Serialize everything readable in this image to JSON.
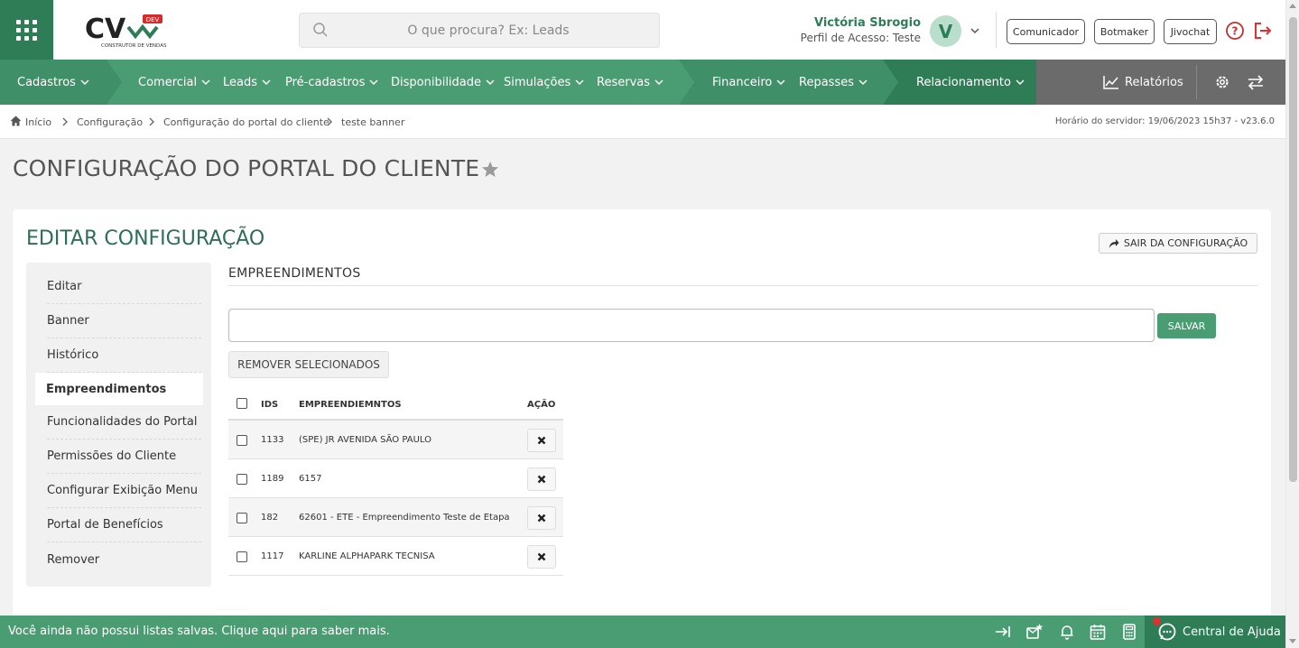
{
  "header": {
    "search_placeholder": "O que procura? Ex: Leads",
    "user_name": "Victória Sbrogio",
    "user_profile": "Perfil de Acesso: Teste",
    "avatar_letter": "V",
    "buttons": [
      "Comunicador",
      "Botmaker",
      "Jivochat"
    ],
    "logo_badge": "DEV",
    "logo_tagline": "CONSTRUTOR DE VENDAS"
  },
  "nav": {
    "items": [
      "Cadastros",
      "Comercial",
      "Leads",
      "Pré-cadastros",
      "Disponibilidade",
      "Simulações",
      "Reservas",
      "Financeiro",
      "Repasses",
      "Relacionamento"
    ],
    "reports": "Relatórios"
  },
  "breadcrumb": {
    "items": [
      "Início",
      "Configuração",
      "Configuração do portal do cliente",
      "teste banner"
    ],
    "server_time": "Horário do servidor: 19/06/2023 15h37 - v23.6.0"
  },
  "page": {
    "title": "CONFIGURAÇÃO DO PORTAL DO CLIENTE",
    "card_title": "EDITAR CONFIGURAÇÃO",
    "exit_label": "SAIR DA CONFIGURAÇÃO",
    "section_title": "EMPREENDIMENTOS",
    "input_value": "",
    "save_label": "SALVAR",
    "remove_selected_label": "REMOVER SELECIONADOS"
  },
  "side_menu": {
    "items": [
      "Editar",
      "Banner",
      "Histórico",
      "Empreendimentos",
      "Funcionalidades do Portal",
      "Permissões do Cliente",
      "Configurar Exibição Menu",
      "Portal de Benefícios",
      "Remover"
    ],
    "active": "Empreendimentos"
  },
  "table": {
    "headers": [
      "IDS",
      "EMPREENDIEMNTOS",
      "AÇÃO"
    ],
    "rows": [
      {
        "id": "1133",
        "name": "(SPE) JR AVENIDA SÃO PAULO"
      },
      {
        "id": "1189",
        "name": "6157"
      },
      {
        "id": "182",
        "name": "62601 - ETE - Empreendimento Teste de Etapa"
      },
      {
        "id": "1117",
        "name": "KARLINE ALPHAPARK TECNISA"
      }
    ]
  },
  "footer": {
    "message": "Você ainda não possui listas salvas. Clique aqui para saber mais.",
    "help_center": "Central de Ajuda"
  },
  "colors": {
    "brand_dark": "#2e7d57",
    "brand": "#4a9c73",
    "title_green": "#2e6e56"
  }
}
